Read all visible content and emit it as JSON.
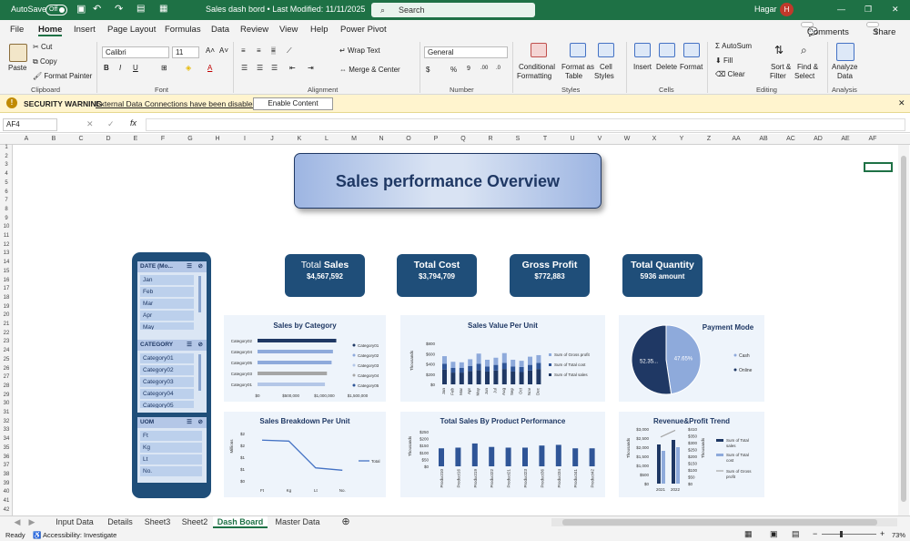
{
  "titlebar": {
    "autosave": "AutoSave",
    "toggle": "Off",
    "doc_title": "Sales dash bord • Last Modified: 11/11/2025",
    "search": "Search",
    "user": "Hagar",
    "avatar": "H"
  },
  "menu": [
    "File",
    "Home",
    "Insert",
    "Page Layout",
    "Formulas",
    "Data",
    "Review",
    "View",
    "Help",
    "Power Pivot"
  ],
  "menu_right": {
    "comments": "Comments",
    "share": "Share"
  },
  "ribbon": {
    "paste": "Paste",
    "cut": "Cut",
    "copy": "Copy",
    "format_painter": "Format Painter",
    "clipboard": "Clipboard",
    "font_name": "Calibri",
    "font_size": "11",
    "font": "Font",
    "wrap_text": "Wrap Text",
    "merge_center": "Merge & Center",
    "alignment": "Alignment",
    "number_format": "General",
    "number": "Number",
    "conditional": "Conditional",
    "formatting": "Formatting",
    "format_as": "Format as",
    "table": "Table",
    "cell": "Cell",
    "styles_btn": "Styles",
    "styles": "Styles",
    "insert": "Insert",
    "delete": "Delete",
    "format": "Format",
    "cells": "Cells",
    "autosum": "AutoSum",
    "fill": "Fill",
    "clear": "Clear",
    "sort": "Sort &",
    "filter": "Filter",
    "find": "Find &",
    "select": "Select",
    "editing": "Editing",
    "analyze": "Analyze",
    "data": "Data",
    "analysis": "Analysis"
  },
  "security": {
    "label": "SECURITY WARNING",
    "message": "External Data Connections have been disabled",
    "button": "Enable Content"
  },
  "formula_bar": {
    "cell_ref": "AF4",
    "fx": "fx",
    "value": ""
  },
  "columns": [
    "A",
    "B",
    "C",
    "D",
    "E",
    "F",
    "G",
    "H",
    "I",
    "J",
    "K",
    "L",
    "M",
    "N",
    "O",
    "P",
    "Q",
    "R",
    "S",
    "T",
    "U",
    "V",
    "W",
    "X",
    "Y",
    "Z",
    "AA",
    "AB",
    "AC",
    "AD",
    "AE",
    "AF"
  ],
  "dashboard": {
    "title": "Sales performance Overview",
    "kpis": [
      {
        "label_a": "Total ",
        "label_b": "Sales",
        "value": "$4,567,592"
      },
      {
        "label_a": "Total Cost",
        "label_b": "",
        "value": "$3,794,709"
      },
      {
        "label_a": "Gross Profit",
        "label_b": "",
        "value": "$772,883"
      },
      {
        "label_a": "Total Quantity",
        "label_b": "",
        "value": "5936  amount"
      }
    ],
    "slicers": {
      "date": {
        "title": "DATE (Mo...",
        "items": [
          "Jan",
          "Feb",
          "Mar",
          "Apr",
          "May"
        ]
      },
      "category": {
        "title": "CATEGORY",
        "items": [
          "Category01",
          "Category02",
          "Category03",
          "Category04",
          "Category05"
        ]
      },
      "uom": {
        "title": "UOM",
        "items": [
          "Ft",
          "Kg",
          "Lt",
          "No."
        ]
      }
    },
    "chart_titles": {
      "cat": "Sales by Category",
      "unit": "Sales Value Per Unit",
      "pay": "Payment Mode",
      "brk": "Sales Breakdown Per Unit",
      "prod": "Total Sales By Product Performance",
      "rev": "Revenue&Profit Trend"
    }
  },
  "chart_data": [
    {
      "type": "bar",
      "title": "Sales by Category",
      "categories": [
        "Category02",
        "Category04",
        "Category05",
        "Category03",
        "Category01"
      ],
      "values": [
        1180000,
        1130000,
        1110000,
        1040000,
        1010000
      ],
      "xticks": [
        "$0",
        "$500,000",
        "$1,000,000",
        "$1,500,000"
      ],
      "xlim": [
        0,
        1500000
      ],
      "legend": [
        "Category01",
        "Category02",
        "Category03",
        "Category04",
        "Category05"
      ],
      "legend_position": "right"
    },
    {
      "type": "bar",
      "title": "Sales Value Per Unit",
      "ylabel": "Thousands",
      "yticks": [
        "$0",
        "$200",
        "$400",
        "$600",
        "$800"
      ],
      "ylim": [
        0,
        800
      ],
      "categories": [
        "Jan",
        "Feb",
        "Mar",
        "Apr",
        "May",
        "Jun",
        "Jul",
        "Aug",
        "Sep",
        "Oct",
        "Nov",
        "Dec"
      ],
      "series": [
        {
          "name": "Sum of Total sales",
          "values": [
            290,
            230,
            230,
            260,
            280,
            250,
            270,
            300,
            250,
            240,
            270,
            300
          ]
        },
        {
          "name": "Sum of Total cost",
          "values": [
            110,
            90,
            90,
            100,
            120,
            100,
            110,
            120,
            100,
            100,
            110,
            120
          ]
        },
        {
          "name": "Sum of Gross profit",
          "values": [
            150,
            120,
            110,
            130,
            200,
            130,
            140,
            190,
            130,
            120,
            160,
            150
          ]
        }
      ],
      "legend_position": "right"
    },
    {
      "type": "pie",
      "title": "Payment Mode",
      "series": [
        {
          "name": "Cash",
          "value": 47.65,
          "label": "47.65%"
        },
        {
          "name": "Online",
          "value": 52.35,
          "label": "52.35..."
        }
      ],
      "legend": [
        "Cash",
        "Online"
      ],
      "legend_position": "right"
    },
    {
      "type": "line",
      "title": "Sales Breakdown Per Unit",
      "ylabel": "Millions",
      "yticks": [
        "$0",
        "$1",
        "$1",
        "$2",
        "$2"
      ],
      "categories": [
        "Ft",
        "Kg",
        "Lt",
        "No."
      ],
      "series": [
        {
          "name": "Total",
          "values": [
            1.72,
            1.68,
            0.55,
            0.45
          ]
        }
      ],
      "legend_position": "right"
    },
    {
      "type": "bar",
      "title": "Total Sales By Product Performance",
      "ylabel": "Thousands",
      "yticks": [
        "$0",
        "$50",
        "$100",
        "$150",
        "$200",
        "$250"
      ],
      "ylim": [
        0,
        250
      ],
      "categories": [
        "Product10",
        "Product16",
        "Product19",
        "Product22",
        "Product21",
        "Product23",
        "Product36",
        "Product34",
        "Product41",
        "Product42"
      ],
      "values": [
        130,
        135,
        165,
        140,
        135,
        135,
        150,
        155,
        130,
        130
      ]
    },
    {
      "type": "bar",
      "title": "Revenue&Profit Trend",
      "ylabel": "Thousands",
      "yticks_left": [
        "$0",
        "$500",
        "$1,000",
        "$1,500",
        "$2,000",
        "$2,500",
        "$3,000"
      ],
      "yticks_right": [
        "$0",
        "$50",
        "$100",
        "$150",
        "$200",
        "$250",
        "$300",
        "$350",
        "$410"
      ],
      "categories": [
        "2021",
        "2022"
      ],
      "series": [
        {
          "name": "Sum of Total sales",
          "values": [
            2150,
            2400
          ]
        },
        {
          "name": "Sum of Total cost",
          "values": [
            1800,
            2000
          ]
        },
        {
          "name": "Sum of Gross profit",
          "values": [
            350,
            400
          ]
        }
      ],
      "legend_position": "right"
    }
  ],
  "sheets": {
    "tabs": [
      "Input Data",
      "Details",
      "Sheet3",
      "Sheet2",
      "Dash Board",
      "Master Data"
    ],
    "active": "Dash Board"
  },
  "status": {
    "ready": "Ready",
    "accessibility": "Accessibility: Investigate",
    "zoom": "73%"
  }
}
